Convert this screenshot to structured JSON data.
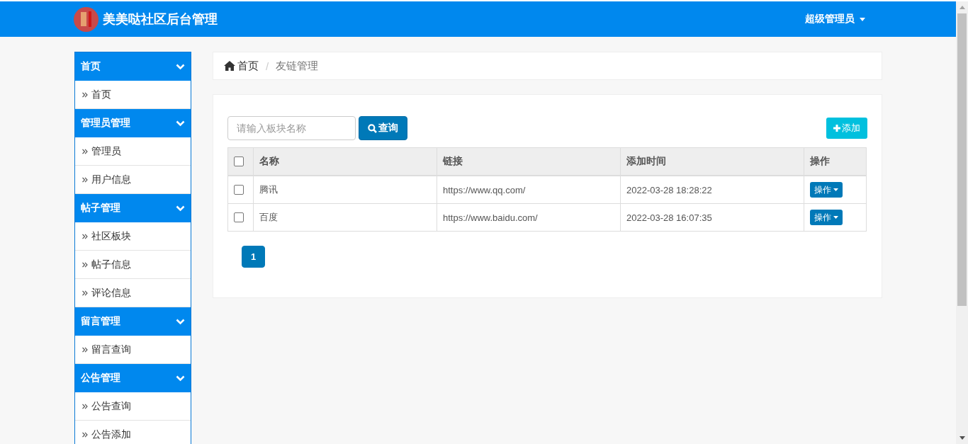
{
  "header": {
    "title": "美美哒社区后台管理",
    "user": "超级管理员"
  },
  "sidebar": {
    "groups": [
      {
        "title": "首页",
        "expanded": true,
        "items": [
          "首页"
        ]
      },
      {
        "title": "管理员管理",
        "expanded": true,
        "items": [
          "管理员",
          "用户信息"
        ]
      },
      {
        "title": "帖子管理",
        "expanded": true,
        "items": [
          "社区板块",
          "帖子信息",
          "评论信息"
        ]
      },
      {
        "title": "留言管理",
        "expanded": true,
        "items": [
          "留言查询"
        ]
      },
      {
        "title": "公告管理",
        "expanded": true,
        "items": [
          "公告查询",
          "公告添加"
        ]
      }
    ]
  },
  "breadcrumb": {
    "separator": "/",
    "items": [
      "首页",
      "友链管理"
    ]
  },
  "search": {
    "placeholder": "请输入板块名称",
    "button": "查询"
  },
  "add_button": "添加",
  "table": {
    "select_all_checked": false,
    "columns": [
      "名称",
      "链接",
      "添加时间",
      "操作"
    ],
    "rows": [
      {
        "checked": false,
        "name": "腾讯",
        "link": "https://www.qq.com/",
        "time": "2022-03-28 18:28:22",
        "action": "操作"
      },
      {
        "checked": false,
        "name": "百度",
        "link": "https://www.baidu.com/",
        "time": "2022-03-28 16:07:35",
        "action": "操作"
      }
    ]
  },
  "pagination": [
    {
      "label": "1",
      "selected": true
    }
  ]
}
